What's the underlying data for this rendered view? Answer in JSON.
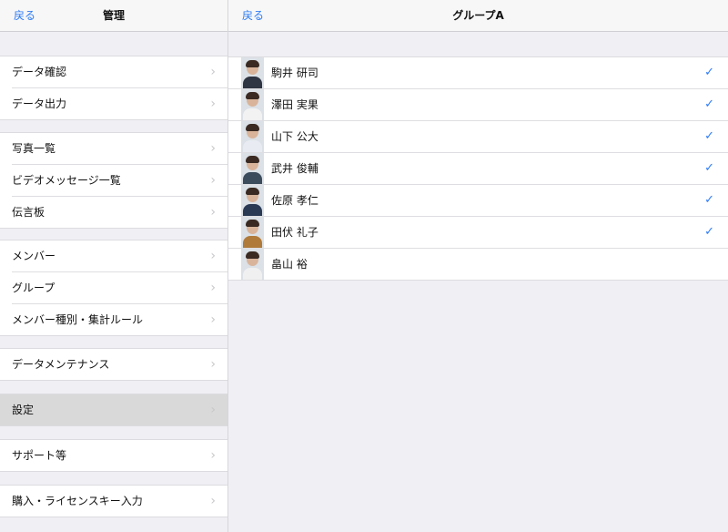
{
  "left": {
    "back_label": "戻る",
    "title": "管理",
    "groups": [
      [
        "データ確認",
        "データ出力"
      ],
      [
        "写真一覧",
        "ビデオメッセージ一覧",
        "伝言板"
      ],
      [
        "メンバー",
        "グループ",
        "メンバー種別・集計ルール"
      ],
      [
        "データメンテナンス"
      ],
      [
        "設定"
      ],
      [
        "サポート等"
      ],
      [
        "購入・ライセンスキー入力"
      ]
    ]
  },
  "right": {
    "back_label": "戻る",
    "title": "グループA",
    "members": [
      {
        "name": "駒井 研司",
        "checked": true
      },
      {
        "name": "澤田 実果",
        "checked": true
      },
      {
        "name": "山下 公大",
        "checked": true
      },
      {
        "name": "武井 俊輔",
        "checked": true
      },
      {
        "name": "佐原 孝仁",
        "checked": true
      },
      {
        "name": "田伏 礼子",
        "checked": true
      },
      {
        "name": "畠山 裕",
        "checked": false
      }
    ]
  },
  "icons": {
    "chevron": "›",
    "check": "✓"
  },
  "colors": {
    "accent": "#2e7cf6",
    "selected_row": "#d9d9d9",
    "background": "#efeff4"
  }
}
